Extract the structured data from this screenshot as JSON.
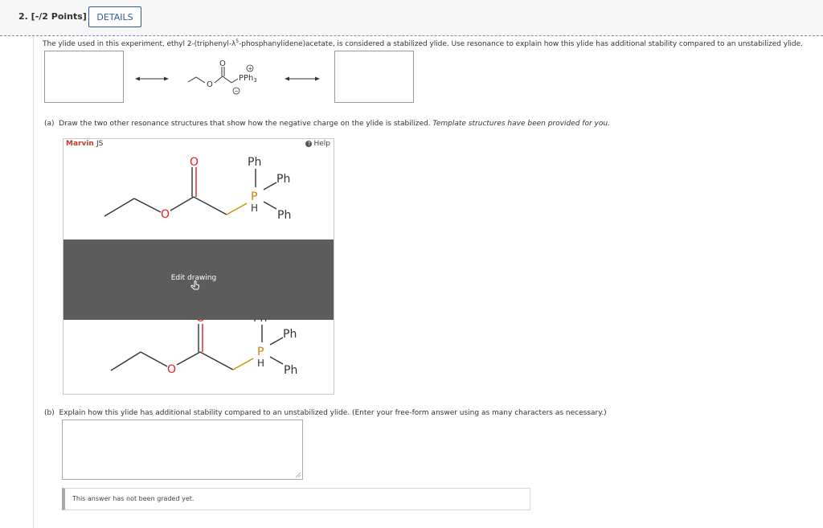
{
  "question": {
    "number_label": "2. [-/2 Points]",
    "details_label": "DETAILS",
    "intro_text_before": "The ylide used in this experiment, ethyl 2-(triphenyl-λ",
    "intro_sup": "5",
    "intro_text_after": "-phosphanylidene)acetate, is considered a stabilized ylide. Use resonance to explain how this ylide has additional stability compared to an unstabilized ylide."
  },
  "structure": {
    "carbonyl_O": "O",
    "ester_O": "O",
    "pph3": "PPh",
    "pph3_sub": "3",
    "plus": "+",
    "minus": "−"
  },
  "part_a": {
    "prefix": "(a)",
    "text": "Draw the two other resonance structures that show how the negative charge on the ylide is stabilized.",
    "italic_text": "Template structures have been provided for you."
  },
  "marvin": {
    "brand": "Marvin",
    "brand_suffix": "JS",
    "help_label": "Help",
    "edit_label": "Edit drawing",
    "molecule": {
      "O_carbonyl": "O",
      "O_ester": "O",
      "P": "P",
      "H": "H",
      "Ph_top": "Ph",
      "Ph_right_top": "Ph",
      "Ph_right_bottom": "Ph"
    }
  },
  "part_b": {
    "prefix": "(b)",
    "text": "Explain how this ylide has additional stability compared to an unstabilized ylide. (Enter your free-form answer using as many characters as necessary.)"
  },
  "answer": {
    "value": "",
    "status_text": "This answer has not been graded yet."
  },
  "colors": {
    "accent": "#2b5d9b",
    "oxygen": "#e02020",
    "phosphorus": "#d08000",
    "marvin_brand": "#c0392b",
    "overlay": "#5c5c5c"
  }
}
